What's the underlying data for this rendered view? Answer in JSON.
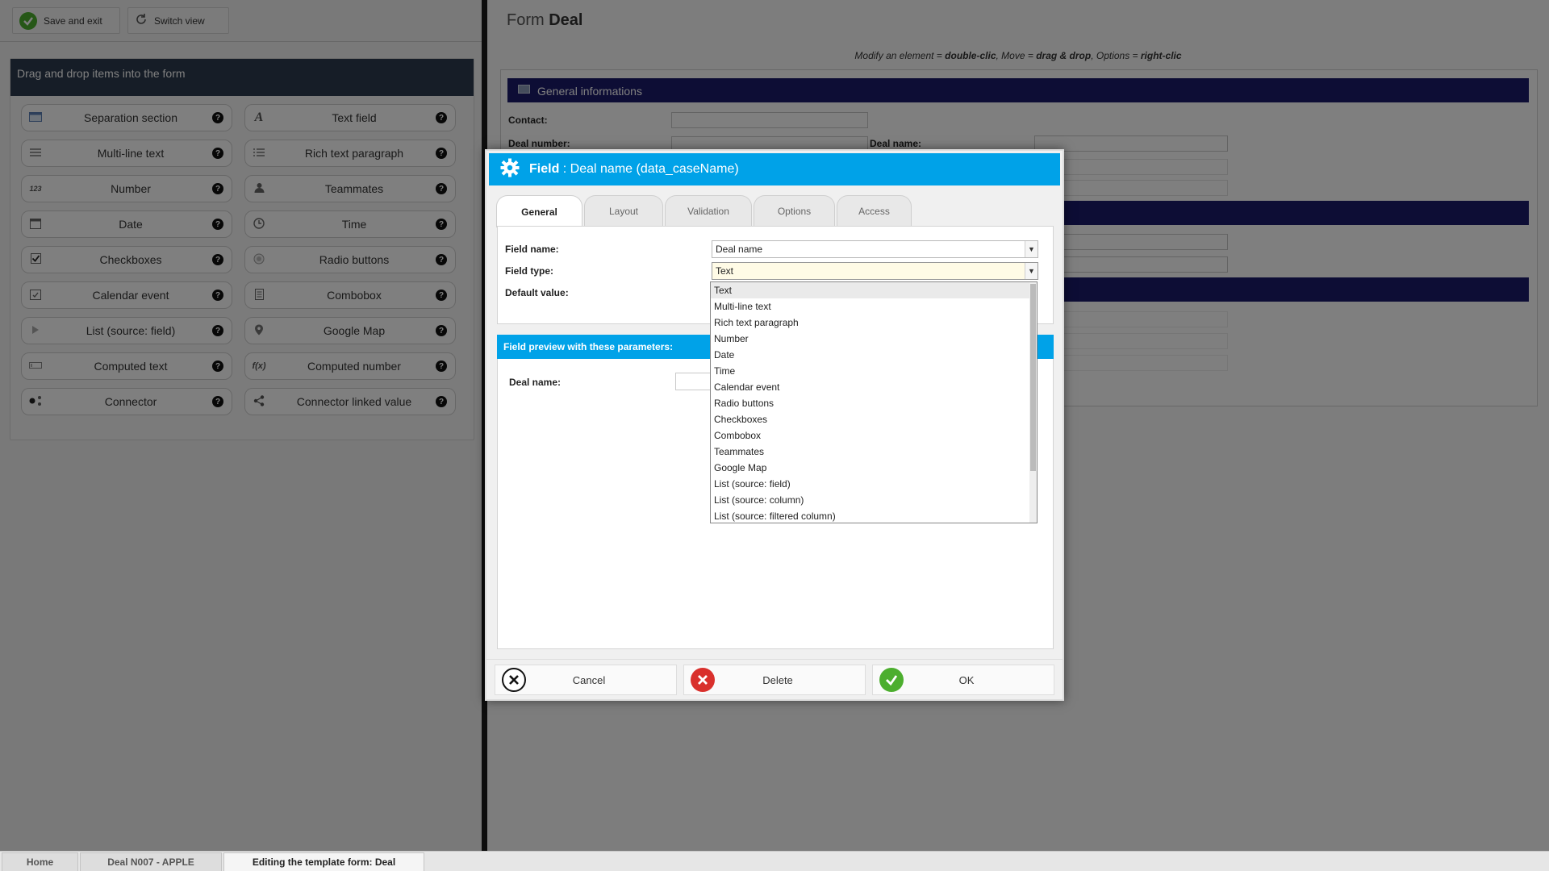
{
  "toolbar": {
    "save_exit": "Save and exit",
    "switch_view": "Switch view"
  },
  "palette": {
    "title": "Drag and drop items into the form",
    "items": [
      {
        "label": "Separation section",
        "icon": "section-icon"
      },
      {
        "label": "Text field",
        "icon": "text-a-icon"
      },
      {
        "label": "Multi-line text",
        "icon": "lines-icon"
      },
      {
        "label": "Rich text paragraph",
        "icon": "list-icon"
      },
      {
        "label": "Number",
        "icon": "number-icon",
        "glyph": "123"
      },
      {
        "label": "Teammates",
        "icon": "user-icon"
      },
      {
        "label": "Date",
        "icon": "calendar-icon"
      },
      {
        "label": "Time",
        "icon": "clock-icon"
      },
      {
        "label": "Checkboxes",
        "icon": "checkbox-icon"
      },
      {
        "label": "Radio buttons",
        "icon": "radio-icon"
      },
      {
        "label": "Calendar event",
        "icon": "calendar-event-icon"
      },
      {
        "label": "Combobox",
        "icon": "combobox-icon"
      },
      {
        "label": "List (source: field)",
        "icon": "play-icon"
      },
      {
        "label": "Google Map",
        "icon": "map-pin-icon"
      },
      {
        "label": "Computed text",
        "icon": "computed-text-icon"
      },
      {
        "label": "Computed number",
        "icon": "fx-icon",
        "glyph": "f(x)"
      },
      {
        "label": "Connector",
        "icon": "connector-icon"
      },
      {
        "label": "Connector linked value",
        "icon": "share-icon"
      }
    ],
    "help": "?"
  },
  "form": {
    "title_prefix": "Form",
    "title_name": "Deal",
    "hint_parts": {
      "a": "Modify an element = ",
      "b": "double-clic",
      "c": ", Move = ",
      "d": "drag & drop",
      "e": ", Options = ",
      "f": "right-clic"
    },
    "section1": "General informations",
    "contact_label": "Contact:",
    "deal_number_label": "Deal number:",
    "deal_name_label": "Deal name:"
  },
  "dialog": {
    "title_bold": "Field",
    "title_rest": " : Deal name (data_caseName)",
    "tabs": [
      "General",
      "Layout",
      "Validation",
      "Options",
      "Access"
    ],
    "active_tab": "General",
    "field_name_label": "Field name:",
    "field_name_value": "Deal name",
    "field_type_label": "Field type:",
    "field_type_value": "Text",
    "default_value_label": "Default value:",
    "preview_title": "Field preview with these parameters:",
    "preview_label": "Deal name:",
    "type_options": [
      "Text",
      "Multi-line text",
      "Rich text paragraph",
      "Number",
      "Date",
      "Time",
      "Calendar event",
      "Radio buttons",
      "Checkboxes",
      "Combobox",
      "Teammates",
      "Google Map",
      "List (source: field)",
      "List (source: column)",
      "List (source: filtered column)"
    ],
    "cancel": "Cancel",
    "delete": "Delete",
    "ok": "OK"
  },
  "taskbar": [
    "Home",
    "Deal N007 - APPLE",
    "Editing the template form: Deal"
  ],
  "colors": {
    "dialog_header": "#00a2e8",
    "section_bar": "#1b1a6b",
    "ok_green": "#4cae2e",
    "delete_red": "#d9302c"
  }
}
